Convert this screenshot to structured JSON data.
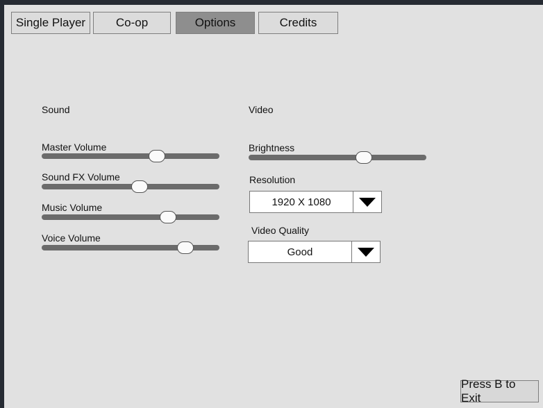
{
  "tabs": [
    {
      "label": "Single Player",
      "active": false
    },
    {
      "label": "Co-op",
      "active": false
    },
    {
      "label": "Options",
      "active": true
    },
    {
      "label": "Credits",
      "active": false
    }
  ],
  "sound": {
    "title": "Sound",
    "sliders": [
      {
        "label": "Master Volume",
        "value": 0.65
      },
      {
        "label": "Sound FX Volume",
        "value": 0.55
      },
      {
        "label": "Music Volume",
        "value": 0.71
      },
      {
        "label": "Voice Volume",
        "value": 0.81
      }
    ]
  },
  "video": {
    "title": "Video",
    "brightness": {
      "label": "Brightness",
      "value": 0.65
    },
    "resolution": {
      "label": "Resolution",
      "value": "1920 X 1080"
    },
    "quality": {
      "label": "Video Quality",
      "value": "Good"
    }
  },
  "exit_label": "Press B to Exit"
}
